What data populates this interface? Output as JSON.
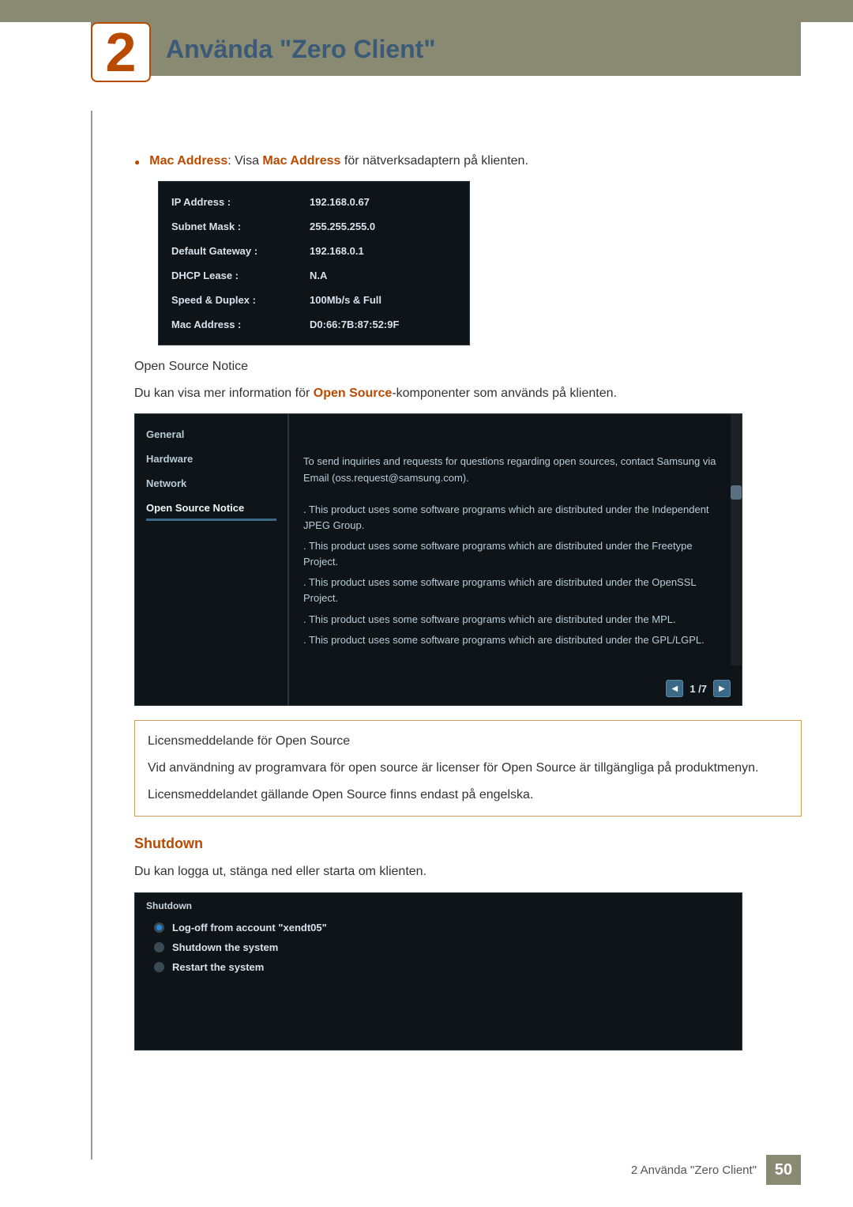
{
  "chapter": {
    "number": "2",
    "title": "Använda \"Zero Client\""
  },
  "bullet": {
    "label_strong": "Mac Address",
    "label_rest": ": Visa ",
    "label_em": "Mac Address",
    "label_tail": " för nätverksadaptern på klienten."
  },
  "network": {
    "rows": [
      {
        "label": "IP Address :",
        "value": "192.168.0.67"
      },
      {
        "label": "Subnet Mask :",
        "value": "255.255.255.0"
      },
      {
        "label": "Default Gateway :",
        "value": "192.168.0.1"
      },
      {
        "label": "DHCP Lease :",
        "value": "N.A"
      },
      {
        "label": "Speed & Duplex :",
        "value": "100Mb/s & Full"
      },
      {
        "label": "Mac Address :",
        "value": "D0:66:7B:87:52:9F"
      }
    ]
  },
  "osn": {
    "heading": "Open Source Notice",
    "lead_pre": "Du kan visa mer information för ",
    "lead_em": "Open Source",
    "lead_post": "-komponenter som används på klienten.",
    "sidebar": [
      "General",
      "Hardware",
      "Network",
      "Open Source Notice"
    ],
    "active_index": 3,
    "paras": [
      "To send inquiries and requests for questions regarding open sources, contact Samsung via Email (oss.request@samsung.com).",
      ". This product uses some software programs which are distributed under the Independent JPEG Group.",
      ". This product uses some software programs which are distributed under the Freetype Project.",
      ". This product uses some software programs which are distributed under the OpenSSL Project.",
      ". This product uses some software programs which are distributed under the MPL.",
      ". This product uses some software programs which are distributed under the GPL/LGPL."
    ],
    "pager": {
      "prev": "◀",
      "label": "1 /7",
      "next": "▶"
    }
  },
  "note": {
    "p1": "Licensmeddelande för Open Source",
    "p2": "Vid användning av programvara för open source är licenser för Open Source är tillgängliga på produktmenyn.",
    "p3": "Licensmeddelandet gällande Open Source finns endast på engelska."
  },
  "shutdown": {
    "heading": "Shutdown",
    "lead": "Du kan logga ut, stänga ned eller starta om klienten.",
    "title": "Shutdown",
    "options": [
      {
        "label": "Log-off from account \"xendt05\"",
        "selected": true
      },
      {
        "label": "Shutdown the system",
        "selected": false
      },
      {
        "label": "Restart the system",
        "selected": false
      }
    ]
  },
  "footer": {
    "text": "2 Använda \"Zero Client\"",
    "page": "50"
  }
}
